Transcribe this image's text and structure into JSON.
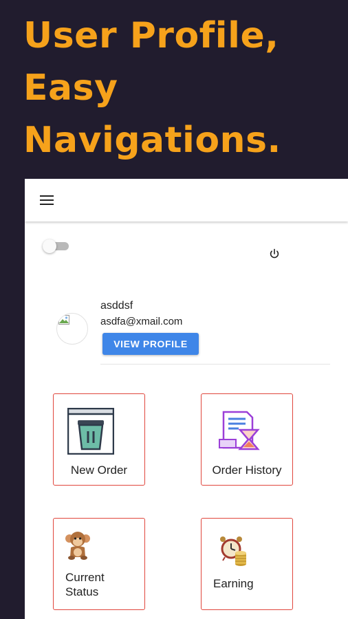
{
  "promo": {
    "headline_lines": [
      "User Profile,",
      "Easy",
      "Navigations."
    ]
  },
  "theme": {
    "background": "#211c2e",
    "headline_color": "#f6a21b",
    "accent_blue": "#3f86e8",
    "card_border": "#e0453c"
  },
  "app": {
    "toolbar": {
      "menu_icon": "hamburger-menu-icon"
    },
    "toggle": {
      "state": "off"
    },
    "power_icon": "power-icon",
    "profile": {
      "name": "asddsf",
      "email": "asdfa@xmail.com",
      "view_button": "VIEW PROFILE"
    },
    "tiles": [
      {
        "label": "New Order",
        "icon": "trash-bin-icon"
      },
      {
        "label": "Order History",
        "icon": "document-hourglass-icon"
      },
      {
        "label": "Current Status",
        "label_lines": [
          "Current",
          "Status"
        ],
        "icon": "monkey-icon"
      },
      {
        "label": "Earning",
        "icon": "alarm-clock-coins-icon"
      }
    ]
  }
}
